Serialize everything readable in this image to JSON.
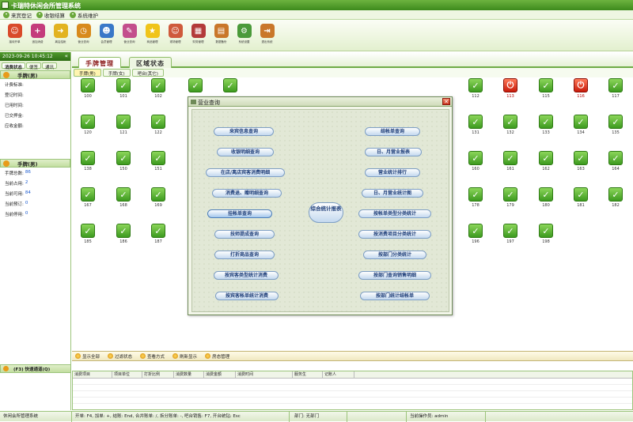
{
  "app": {
    "title": "卡瑞特休闲会所管理系统"
  },
  "menu": [
    {
      "label": "来宾登记",
      "icon": "person-icon"
    },
    {
      "label": "收银结算",
      "icon": "cash-icon"
    },
    {
      "label": "系统维护",
      "icon": "wrench-icon"
    }
  ],
  "toolbar": [
    {
      "label": "接待开单",
      "icon": "reception-icon",
      "color": "#d94a2a",
      "glyph": "☺"
    },
    {
      "label": "追加消费",
      "icon": "add-consume-icon",
      "color": "#c43c7c",
      "glyph": "+"
    },
    {
      "label": "离店结帐",
      "icon": "checkout-arrow-icon",
      "color": "#e2b320",
      "glyph": "➜"
    },
    {
      "label": "营业查询",
      "icon": "clock-icon",
      "color": "#d88a1c",
      "glyph": "◷"
    },
    {
      "label": "会员管理",
      "icon": "members-icon",
      "color": "#3a78c8",
      "glyph": "☻"
    },
    {
      "label": "营业查询",
      "icon": "brush-icon",
      "color": "#c34e8c",
      "glyph": "✎"
    },
    {
      "label": "商品管理",
      "icon": "star-icon",
      "color": "#f0c419",
      "glyph": "★"
    },
    {
      "label": "现场管理",
      "icon": "staff-icon",
      "color": "#cf5a3c",
      "glyph": "☺"
    },
    {
      "label": "财务管理",
      "icon": "building-icon",
      "color": "#b33a3a",
      "glyph": "▦"
    },
    {
      "label": "数据备份",
      "icon": "book-icon",
      "color": "#c9772a",
      "glyph": "▤"
    },
    {
      "label": "系统设置",
      "icon": "gear-icon",
      "color": "#4a9a3a",
      "glyph": "⚙"
    },
    {
      "label": "退出系统",
      "icon": "exit-door-icon",
      "color": "#c9772a",
      "glyph": "⇥"
    }
  ],
  "left": {
    "datetime": "2023-09-26 10:45:12",
    "tabs": [
      "消费状态",
      "便签",
      "通讯"
    ],
    "section1": "手牌(男)",
    "fields1": [
      {
        "label": "计费标准:",
        "value": ""
      },
      {
        "label": "登记时间:",
        "value": ""
      },
      {
        "label": "已用时间:",
        "value": ""
      },
      {
        "label": "已交押金:",
        "value": ""
      },
      {
        "label": "应收金额:",
        "value": ""
      }
    ],
    "section2": "手牌(男)",
    "fields2": [
      {
        "label": "手牌总数:",
        "value": "86"
      },
      {
        "label": "当前占用:",
        "value": "2"
      },
      {
        "label": "当前可用:",
        "value": "84"
      },
      {
        "label": "当前预订:",
        "value": "0"
      },
      {
        "label": "当前停用:",
        "value": "0"
      }
    ]
  },
  "main": {
    "tabs": [
      "手牌管理",
      "区域状态"
    ],
    "subtabs": [
      "手牌(男)",
      "手牌(女)",
      "吧台(其它)"
    ],
    "tables": [
      {
        "n": "100",
        "busy": false
      },
      {
        "n": "101",
        "busy": false
      },
      {
        "n": "102",
        "busy": false
      },
      {
        "n": "112",
        "busy": false
      },
      {
        "n": "113",
        "busy": true
      },
      {
        "n": "115",
        "busy": false
      },
      {
        "n": "116",
        "busy": true
      },
      {
        "n": "117",
        "busy": false
      },
      {
        "n": "120",
        "busy": false
      },
      {
        "n": "121",
        "busy": false
      },
      {
        "n": "122",
        "busy": false
      },
      {
        "n": "131",
        "busy": false
      },
      {
        "n": "132",
        "busy": false
      },
      {
        "n": "133",
        "busy": false
      },
      {
        "n": "134",
        "busy": false
      },
      {
        "n": "135",
        "busy": false
      },
      {
        "n": "138",
        "busy": false
      },
      {
        "n": "150",
        "busy": false
      },
      {
        "n": "151",
        "busy": false
      },
      {
        "n": "160",
        "busy": false
      },
      {
        "n": "161",
        "busy": false
      },
      {
        "n": "162",
        "busy": false
      },
      {
        "n": "163",
        "busy": false
      },
      {
        "n": "164",
        "busy": false
      },
      {
        "n": "167",
        "busy": false
      },
      {
        "n": "168",
        "busy": false
      },
      {
        "n": "169",
        "busy": false
      },
      {
        "n": "178",
        "busy": false
      },
      {
        "n": "179",
        "busy": false
      },
      {
        "n": "180",
        "busy": false
      },
      {
        "n": "181",
        "busy": false
      },
      {
        "n": "182",
        "busy": false
      },
      {
        "n": "185",
        "busy": false
      },
      {
        "n": "186",
        "busy": false
      },
      {
        "n": "187",
        "busy": false
      },
      {
        "n": "196",
        "busy": false
      },
      {
        "n": "197",
        "busy": false
      },
      {
        "n": "198",
        "busy": false
      }
    ],
    "hidden_cells": 5
  },
  "dialog": {
    "title": "营业查询",
    "left_buttons": [
      "来宾信息查询",
      "收银明细查询",
      "在店/离店宾客消费明细",
      "消费退、赠明细查询",
      "挂帐单查询",
      "技师提成查询",
      "打折商品查询",
      "按宾客类型统计消费",
      "按宾客帐单统计消费"
    ],
    "center_button": "综合统计报表",
    "right_buttons": [
      "结帐单查询",
      "日、月营业报表",
      "营业统计排行",
      "日、月营业统计图",
      "按帐单类型分类统计",
      "按消费项目分类统计",
      "按部门分类统计",
      "按部门查询销售明细",
      "按部门统计结帐单"
    ],
    "selected": "挂帐单查询"
  },
  "bottom_actions": [
    "显示全部",
    "过滤状态",
    "查看方式",
    "刷新显示",
    "房态管理"
  ],
  "quick": {
    "header": "(F3) 快速通道(Q)",
    "columns": [
      "消费项目",
      "项目单位",
      "打折比例",
      "消费数量",
      "消费金额",
      "消费时间",
      "服务生",
      "记账人"
    ]
  },
  "status": {
    "app": "休闲会所管理系统",
    "hint": "开单: F4, 加单: +, 结账: End, 合并账单: /, 拆分账单: -, 吧台销售: F7, 开台统钻: Esc",
    "dept": "部门: 无部门",
    "operator": "当前操作员: admin"
  }
}
